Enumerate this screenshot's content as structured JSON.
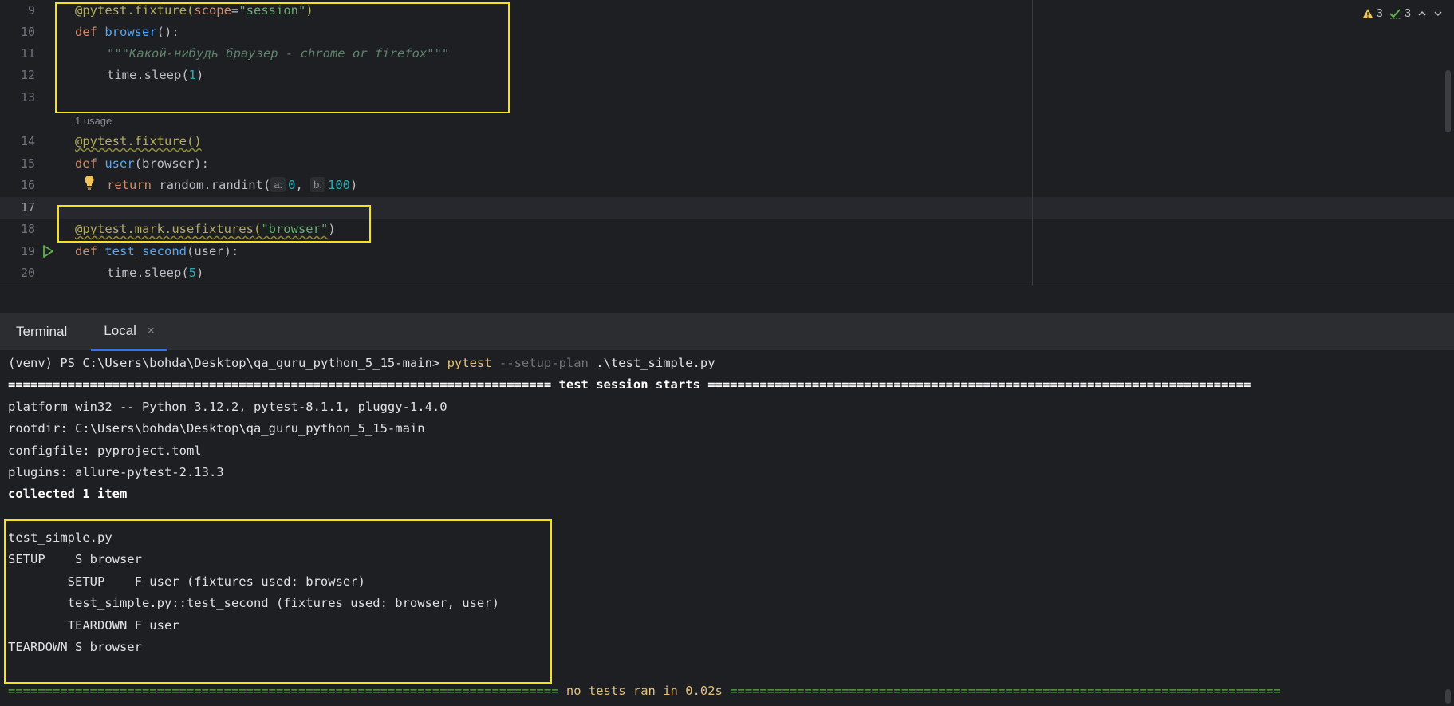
{
  "editor": {
    "line_numbers": [
      "9",
      "10",
      "11",
      "12",
      "13",
      "14",
      "15",
      "16",
      "17",
      "18",
      "19",
      "20"
    ],
    "usage_hint": "1 usage",
    "lines": {
      "l9": {
        "dec": "@pytest.fixture(",
        "param": "scope",
        "eq": "=",
        "str": "\"session\"",
        "close": ")"
      },
      "l10": {
        "kw": "def ",
        "fn": "browser",
        "rest": "():"
      },
      "l11": {
        "doc": "\"\"\"Какой-нибудь браузер - chrome or firefox\"\"\""
      },
      "l12": {
        "pre": "time.sleep(",
        "num": "1",
        "post": ")"
      },
      "l14": {
        "dec": "@pytest.fixture",
        "rest": "()"
      },
      "l15": {
        "kw": "def ",
        "fn": "user",
        "rest": "(browser):"
      },
      "l16": {
        "kw": "return ",
        "pre": "random.randint(",
        "hint_a": "a:",
        "num_a": "0",
        "comma": ", ",
        "hint_b": "b:",
        "num_b": "100",
        "post": ")"
      },
      "l18": {
        "dec": "@pytest.mark.usefixtures",
        "open": "(",
        "str": "\"browser\"",
        "close": ")"
      },
      "l19": {
        "kw": "def ",
        "fn": "test_second",
        "rest": "(user):"
      },
      "l20": {
        "pre": "time.sleep(",
        "num": "5",
        "post": ")"
      }
    },
    "inspections": {
      "warnings": "3",
      "checks": "3"
    }
  },
  "terminal": {
    "title": "Terminal",
    "tab_label": "Local",
    "tab_close": "×",
    "prompt": "(venv) PS C:\\Users\\bohda\\Desktop\\qa_guru_python_5_15-main> ",
    "cmd": "pytest",
    "cmd_opt": " --setup-plan",
    "cmd_arg": " .\\test_simple.py",
    "session_line": "========================================================================= test session starts =========================================================================",
    "platform": "platform win32 -- Python 3.12.2, pytest-8.1.1, pluggy-1.4.0",
    "rootdir": "rootdir: C:\\Users\\bohda\\Desktop\\qa_guru_python_5_15-main",
    "configfile": "configfile: pyproject.toml",
    "plugins": "plugins: allure-pytest-2.13.3",
    "collected": "collected 1 item",
    "plan": [
      "test_simple.py",
      "SETUP    S browser",
      "        SETUP    F user (fixtures used: browser)",
      "        test_simple.py::test_second (fixtures used: browser, user)",
      "        TEARDOWN F user",
      "TEARDOWN S browser"
    ],
    "summary_left": "========================================================================== ",
    "summary_mid": "no tests ran in 0.02s",
    "summary_right": " =========================================================================="
  },
  "colors": {
    "highlight_box": "#f6e11d",
    "background": "#1e1f22",
    "keyword": "#cf8e6d",
    "function": "#56a8f5",
    "string": "#6aab73",
    "decorator": "#b3ae60"
  },
  "icons": [
    "warning-icon",
    "check-icon",
    "chevron-up-icon",
    "chevron-down-icon",
    "lightbulb-icon",
    "run-icon",
    "close-icon"
  ]
}
